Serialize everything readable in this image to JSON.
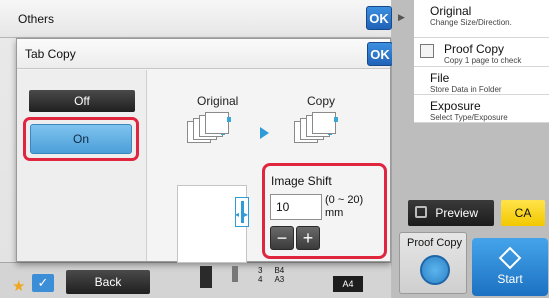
{
  "outer": {
    "title": "Others",
    "ok_label": "OK"
  },
  "dialog": {
    "title": "Tab Copy",
    "ok_label": "OK",
    "off_label": "Off",
    "on_label": "On",
    "original_label": "Original",
    "copy_label": "Copy",
    "image_shift": {
      "title": "Image Shift",
      "value": "10",
      "range": "(0 ~ 20)",
      "unit": "mm",
      "minus_label": "−",
      "plus_label": "+"
    }
  },
  "bottom": {
    "back_label": "Back",
    "trays": [
      {
        "num": "3",
        "size": "B4"
      },
      {
        "num": "4",
        "size": "A3"
      }
    ],
    "paper_size": "A4"
  },
  "right_panel": {
    "items": [
      {
        "label": "Original",
        "sub": "Change Size/Direction."
      },
      {
        "label": "Proof Copy",
        "sub": "Copy 1 page to check"
      },
      {
        "label": "File",
        "sub": "Store Data in Folder"
      },
      {
        "label": "Exposure",
        "sub": "Select Type/Exposure"
      }
    ],
    "preview_label": "Preview",
    "ca_label": "CA",
    "proof_copy_label": "Proof Copy",
    "start_label": "Start"
  },
  "colors": {
    "highlight": "#e0263f",
    "accent_blue": "#2f9bd7",
    "ca_yellow": "#f2c800"
  },
  "icons": [
    "star-icon",
    "checkmark-icon",
    "preview-icon",
    "proof-copy-icon",
    "start-icon",
    "expand-arrow-icon"
  ]
}
